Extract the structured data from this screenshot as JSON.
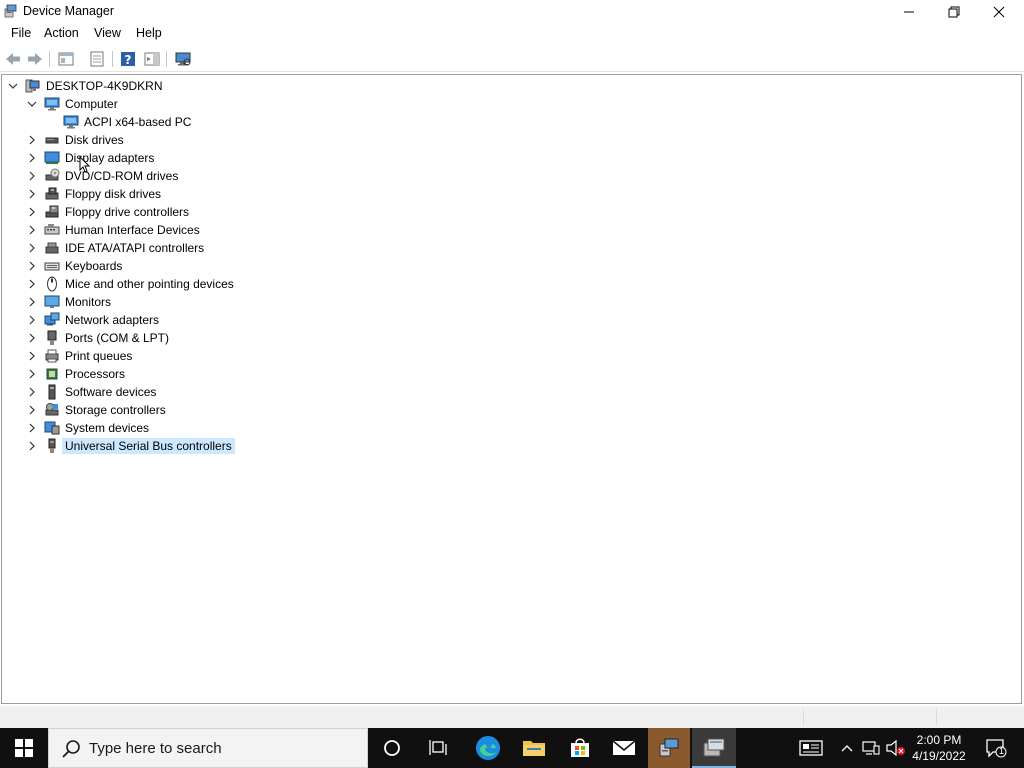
{
  "window": {
    "title": "Device Manager",
    "icon": "device-manager-icon"
  },
  "menu": [
    "File",
    "Action",
    "View",
    "Help"
  ],
  "toolbar": {
    "buttons": [
      "back-icon",
      "forward-icon",
      "show-hide-tree-icon",
      "properties-icon",
      "help-icon",
      "action-pane-icon",
      "scan-hardware-icon"
    ]
  },
  "tree": {
    "root": "DESKTOP-4K9DKRN",
    "computer": {
      "label": "Computer",
      "child": "ACPI x64-based PC"
    },
    "categories": [
      {
        "label": "Disk drives",
        "icon": "disk-drive-icon"
      },
      {
        "label": "Display adapters",
        "icon": "display-adapter-icon"
      },
      {
        "label": "DVD/CD-ROM drives",
        "icon": "dvd-drive-icon"
      },
      {
        "label": "Floppy disk drives",
        "icon": "floppy-disk-icon"
      },
      {
        "label": "Floppy drive controllers",
        "icon": "floppy-controller-icon"
      },
      {
        "label": "Human Interface Devices",
        "icon": "hid-icon"
      },
      {
        "label": "IDE ATA/ATAPI controllers",
        "icon": "ide-controller-icon"
      },
      {
        "label": "Keyboards",
        "icon": "keyboard-icon"
      },
      {
        "label": "Mice and other pointing devices",
        "icon": "mouse-icon"
      },
      {
        "label": "Monitors",
        "icon": "monitor-icon"
      },
      {
        "label": "Network adapters",
        "icon": "network-adapter-icon"
      },
      {
        "label": "Ports (COM & LPT)",
        "icon": "port-icon"
      },
      {
        "label": "Print queues",
        "icon": "printer-icon"
      },
      {
        "label": "Processors",
        "icon": "processor-icon"
      },
      {
        "label": "Software devices",
        "icon": "software-device-icon"
      },
      {
        "label": "Storage controllers",
        "icon": "storage-controller-icon"
      },
      {
        "label": "System devices",
        "icon": "system-device-icon"
      },
      {
        "label": "Universal Serial Bus controllers",
        "icon": "usb-icon",
        "selected": true
      }
    ]
  },
  "taskbar": {
    "search_placeholder": "Type here to search",
    "time": "2:00 PM",
    "date": "4/19/2022",
    "notification_count": "1",
    "pinned": [
      "cortana-icon",
      "task-view-icon",
      "edge-icon",
      "file-explorer-icon",
      "store-icon",
      "mail-icon",
      "device-manager-task-icon",
      "active-app-icon"
    ]
  },
  "colors": {
    "selection": "#cce8ff",
    "taskbar": "#101010",
    "accent": "#0078d7"
  }
}
